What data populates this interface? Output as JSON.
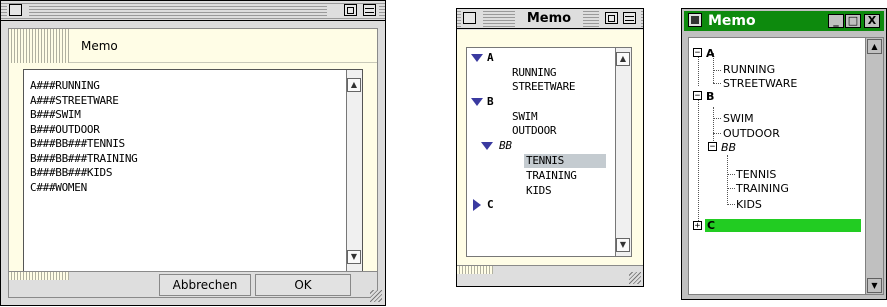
{
  "dialog": {
    "header_label": "Memo",
    "lines": [
      "A###RUNNING",
      "A###STREETWARE",
      "B###SWIM",
      "B###OUTDOOR",
      "B###BB###TENNIS",
      "B###BB###TRAINING",
      "B###BB###KIDS",
      "C###WOMEN"
    ],
    "cancel_label": "Abbrechen",
    "ok_label": "OK"
  },
  "mac_list": {
    "title": "Memo",
    "rows": [
      {
        "text": "A",
        "kind": "parent-open"
      },
      {
        "text": "RUNNING",
        "kind": "child"
      },
      {
        "text": "STREETWARE",
        "kind": "child"
      },
      {
        "text": "B",
        "kind": "parent-open"
      },
      {
        "text": "SWIM",
        "kind": "child"
      },
      {
        "text": "OUTDOOR",
        "kind": "child"
      },
      {
        "text": "BB",
        "kind": "subparent-open"
      },
      {
        "text": "TENNIS",
        "kind": "grandchild-selected"
      },
      {
        "text": "TRAINING",
        "kind": "grandchild"
      },
      {
        "text": "KIDS",
        "kind": "grandchild"
      },
      {
        "text": "C",
        "kind": "parent-closed"
      }
    ]
  },
  "win_tree": {
    "title": "Memo",
    "minimize": "_",
    "maximize": "□",
    "close": "X",
    "nodes": {
      "a": "A",
      "running": "RUNNING",
      "streetware": "STREETWARE",
      "b": "B",
      "swim": "SWIM",
      "outdoor": "OUTDOOR",
      "bb": "BB",
      "tennis": "TENNIS",
      "training": "TRAINING",
      "kids": "KIDS",
      "c": "C"
    },
    "collapse_glyph": "−",
    "expand_glyph": "+",
    "selection_color": "#22cc22",
    "title_color": "#0d8a0d"
  }
}
